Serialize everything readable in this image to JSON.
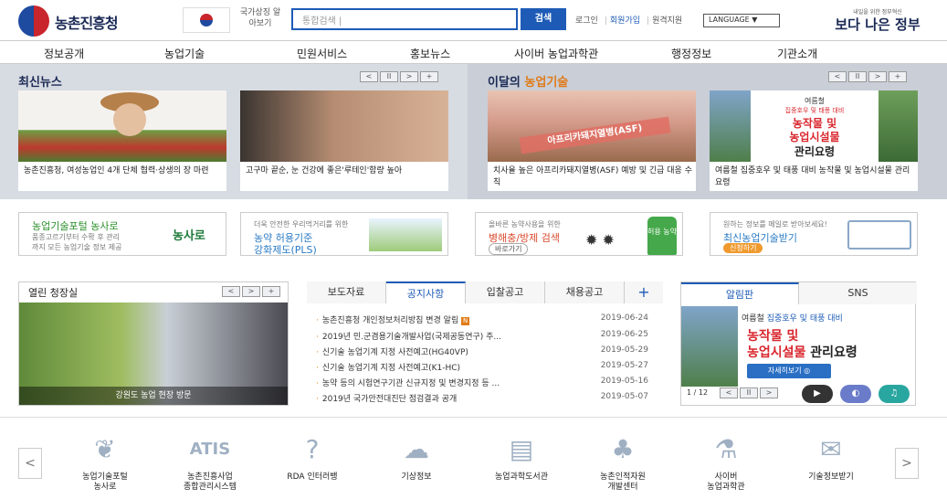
{
  "header": {
    "logo_text": "농촌진흥청",
    "symbol_text": "국가상징 알아보기",
    "search_placeholder": "통합검색 |",
    "search_button": "검색",
    "login": "로그인",
    "join": "회원가입",
    "remote": "원격지원",
    "language": "LANGUAGE ▼",
    "gov_sub": "내일을 위한 정부혁신",
    "gov_main": "보다 나은 정부"
  },
  "nav": [
    "정보공개",
    "농업기술",
    "민원서비스",
    "홍보뉴스",
    "사이버 농업과학관",
    "행정정보",
    "기관소개"
  ],
  "news": {
    "title": "최신뉴스",
    "items": [
      {
        "caption": "농촌진흥청, 여성농업인 4개 단체 협력·상생의 장 마련"
      },
      {
        "caption": "고구마 끝순, 눈 건강에 좋은'루테인'함량 높아"
      }
    ]
  },
  "tech": {
    "title_prefix": "이달의 ",
    "title_accent": "농업기술",
    "items": [
      {
        "caption": "치사율 높은 아프리카돼지열병(ASF) 예방 및 긴급 대응 수칙",
        "img_text": "아프리카돼지열병(ASF)"
      },
      {
        "caption": "여름철 집중호우 및 태풍 대비 농작물 및 농업시설물 관리요령",
        "img_small": "여름철",
        "img_red": "집중호우 및 태풍 대비",
        "img_big1": "농작물 및",
        "img_big2": "농업시설물",
        "img_big3": "관리요령"
      }
    ]
  },
  "controls": {
    "prev": "<",
    "pause": "II",
    "next": ">",
    "plus": "+"
  },
  "banners": [
    {
      "title": "농업기술포털 농사로",
      "sub1": "품종고르기부터 수확 후 관리",
      "sub2": "까지 모든 농업기술 정보 제공",
      "brand": "농사로"
    },
    {
      "top": "더욱 안전한 우리먹거리를 위한",
      "title1": "농약 허용기준",
      "title2": "강화제도(PLS)"
    },
    {
      "top": "올바른 농약사용을 위한",
      "title": "병해충/방제 검색",
      "button": "바로가기",
      "tag": "허용 농약"
    },
    {
      "top": "원하는 정보를 메일로 받아보세요!",
      "title": "최신농업기술받기",
      "button": "신청하기"
    }
  ],
  "hall": {
    "title": "열린 청장실",
    "caption": "강원도 농업 현장 방문"
  },
  "board": {
    "tabs": [
      "보도자료",
      "공지사항",
      "입찰공고",
      "채용공고"
    ],
    "more": "+",
    "items": [
      {
        "title": "농촌진흥청 개인정보처리방침 변경 알림",
        "badge": "N",
        "date": "2019-06-24"
      },
      {
        "title": "2019년 민.군겸용기술개발사업(국제공동연구) 주...",
        "date": "2019-06-25"
      },
      {
        "title": "신기술 농업기계 지정 사전예고(HG40VP)",
        "date": "2019-05-29"
      },
      {
        "title": "신기술 농업기계 지정 사전예고(K1-HC)",
        "date": "2019-05-27"
      },
      {
        "title": "농약 등의 시험연구기관 신규지정 및 변경지정 등 ...",
        "date": "2019-05-16"
      },
      {
        "title": "2019년 국가안전대진단 점검결과 공개",
        "date": "2019-05-07"
      }
    ]
  },
  "alert": {
    "tabs": [
      "알림판",
      "SNS"
    ],
    "line1_a": "여름철 ",
    "line1_b": "집중호우 및 태풍 대비",
    "line2": "농작물 및",
    "line3_a": "농업시설물",
    "line3_b": " 관리요령",
    "button": "자세히보기 ◎",
    "pager": "1 / 12"
  },
  "quick": [
    {
      "l1": "농업기술포털",
      "l2": "농사로",
      "icon": "nongsaro-icon",
      "glyph": "❦"
    },
    {
      "l1": "농촌진흥사업",
      "l2": "종합관리시스템",
      "icon": "atis-icon",
      "glyph": "ATIS"
    },
    {
      "l1": "RDA 인터러뱅",
      "l2": "",
      "icon": "question-icon",
      "glyph": "?"
    },
    {
      "l1": "기상정보",
      "l2": "",
      "icon": "weather-icon",
      "glyph": "☁"
    },
    {
      "l1": "농업과학도서관",
      "l2": "",
      "icon": "book-icon",
      "glyph": "▤"
    },
    {
      "l1": "농촌인적자원",
      "l2": "개발센터",
      "icon": "sprout-icon",
      "glyph": "♣"
    },
    {
      "l1": "사이버",
      "l2": "농업과학관",
      "icon": "flask-icon",
      "glyph": "⚗"
    },
    {
      "l1": "기술정보받기",
      "l2": "",
      "icon": "mail-icon",
      "glyph": "✉"
    }
  ],
  "colors": {
    "primary": "#1e5bb6",
    "navy": "#1b2a55",
    "accent": "#e07b18",
    "red": "#d8262d"
  }
}
